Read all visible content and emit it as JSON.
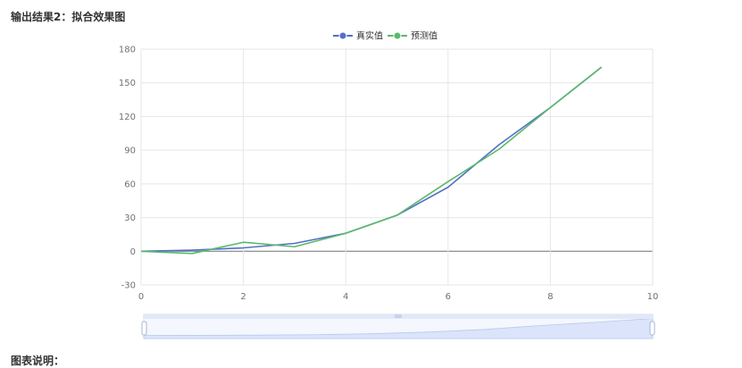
{
  "header": {
    "title": "输出结果2：拟合效果图"
  },
  "footer": {
    "title": "图表说明："
  },
  "colors": {
    "actual": "#5470c6",
    "predicted": "#5ab96b",
    "grid": "#e6e6e6",
    "axis": "#6e7079",
    "zoom_fill": "#dbe4fa"
  },
  "chart_data": {
    "type": "line",
    "title": "",
    "xlabel": "",
    "ylabel": "",
    "xlim": [
      0,
      10
    ],
    "ylim": [
      -30,
      180
    ],
    "xticks": [
      0,
      2,
      4,
      6,
      8,
      10
    ],
    "yticks": [
      -30,
      0,
      30,
      60,
      90,
      120,
      150,
      180
    ],
    "grid": true,
    "legend_position": "top-center",
    "x": [
      0,
      1,
      2,
      3,
      4,
      5,
      6,
      7,
      8,
      9
    ],
    "series": [
      {
        "name": "真实值",
        "values": [
          0,
          1,
          3,
          7,
          16,
          32,
          57,
          95,
          128,
          164
        ]
      },
      {
        "name": "预测值",
        "values": [
          0,
          -2,
          8,
          4,
          16,
          32,
          62,
          91,
          128,
          164
        ]
      }
    ]
  }
}
